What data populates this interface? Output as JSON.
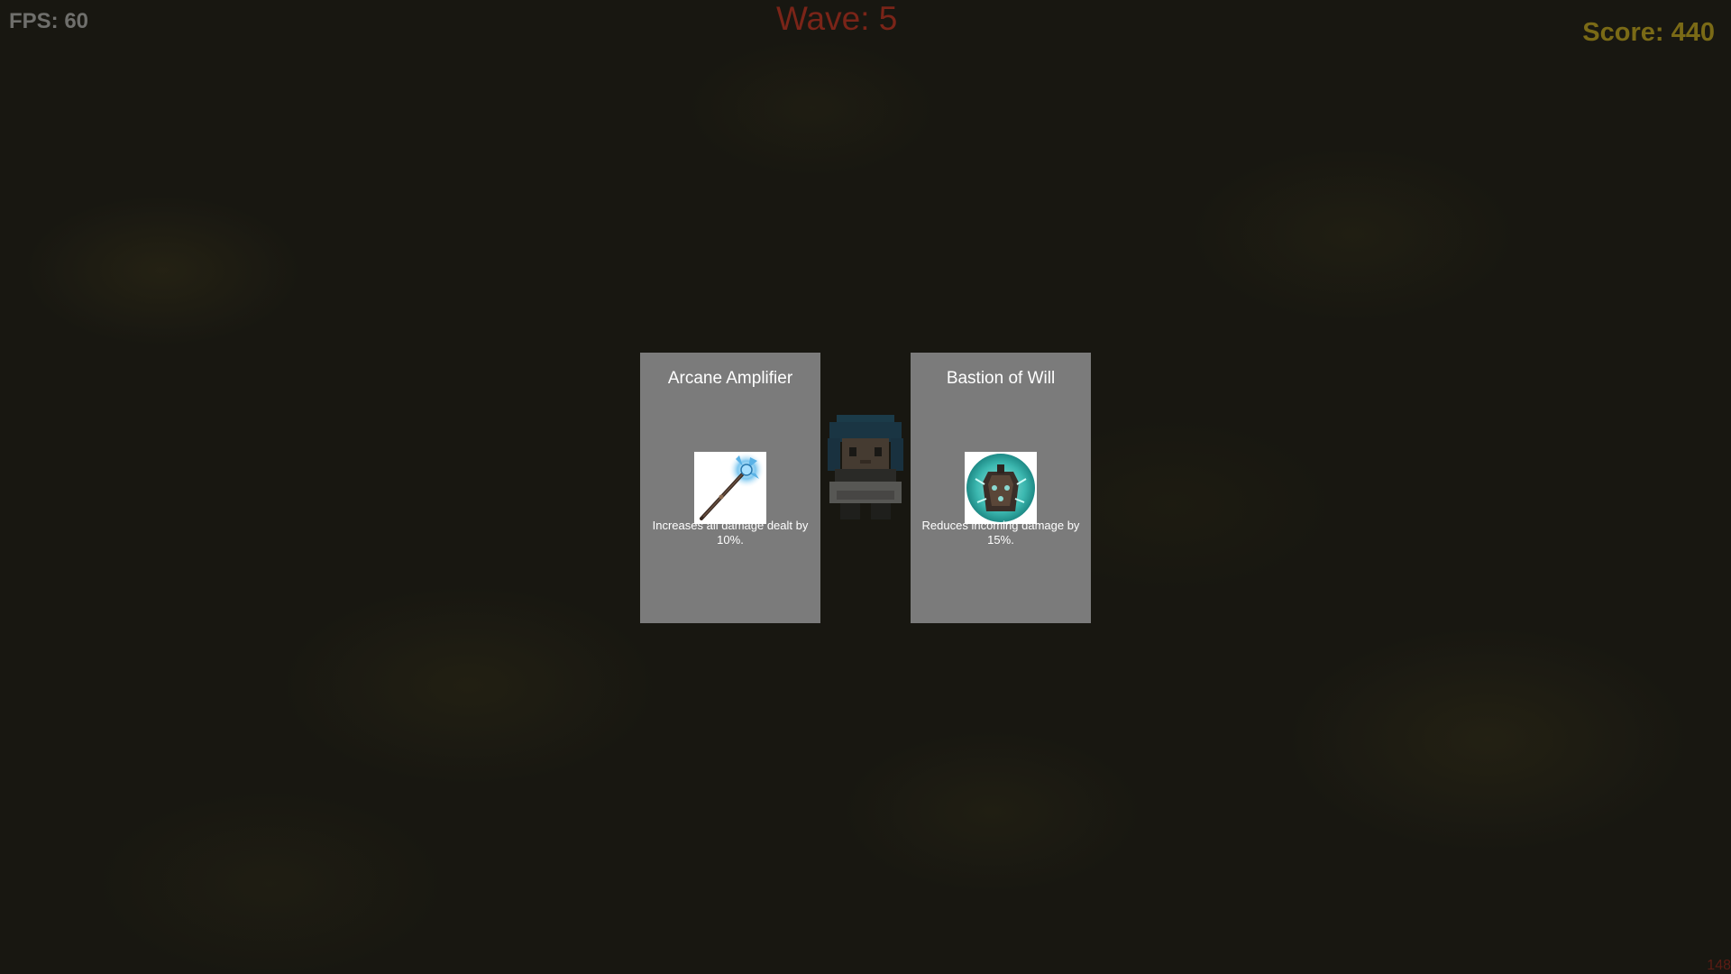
{
  "hud": {
    "fps": "FPS: 60",
    "wave": "Wave: 5",
    "score": "Score: 440",
    "corner_number": "148"
  },
  "upgrades": [
    {
      "title": "Arcane Amplifier",
      "description": "Increases all damage dealt by 10%.",
      "icon": "magic-staff-icon"
    },
    {
      "title": "Bastion of Will",
      "description": "Reduces incoming damage by 15%.",
      "icon": "armor-shield-icon"
    }
  ],
  "colors": {
    "card_background": "#7b7b7b",
    "wave_text": "#7a2418",
    "score_text": "#7a6a16",
    "fps_text": "#6f6f6c"
  }
}
